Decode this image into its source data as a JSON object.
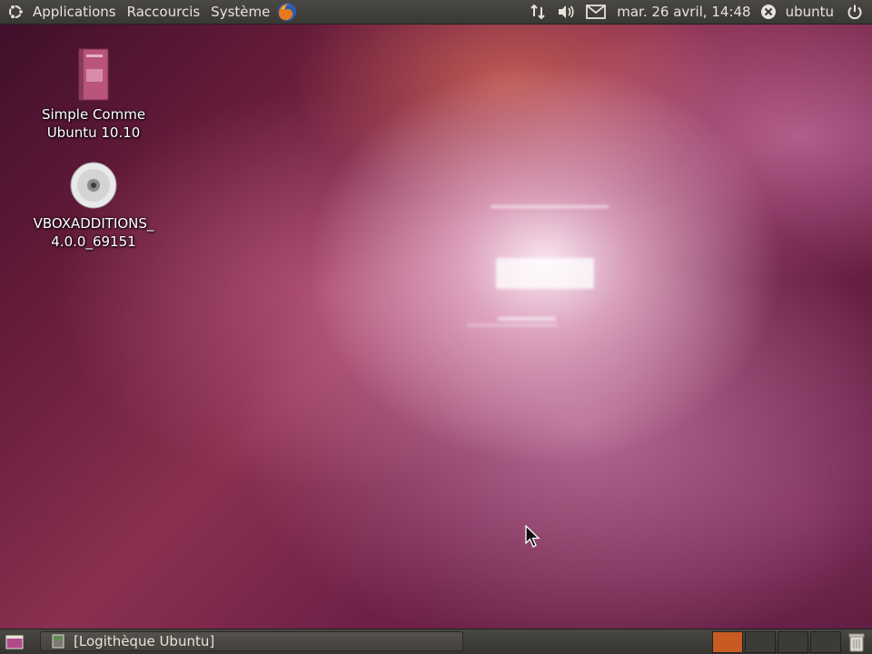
{
  "top_panel": {
    "menu_applications": "Applications",
    "menu_shortcuts": "Raccourcis",
    "menu_system": "Système",
    "clock": "mar. 26 avril, 14:48",
    "user": "ubuntu",
    "icons": [
      "ubuntu-logo-icon",
      "firefox-icon",
      "network-icon",
      "volume-icon",
      "mail-icon",
      "user-status-icon",
      "power-icon"
    ]
  },
  "desktop": {
    "icons": [
      {
        "label": "Simple Comme Ubuntu 10.10",
        "icon": "book-icon"
      },
      {
        "label": "VBOXADDITIONS_ 4.0.0_69151",
        "icon": "cd-icon"
      }
    ]
  },
  "bottom_panel": {
    "taskbar_window": "[Logithèque Ubuntu]",
    "icons": [
      "show-desktop-icon",
      "app-window-icon",
      "trash-icon"
    ],
    "active_workspace_color": "#c75b22"
  },
  "colors": {
    "panel": "#3c3b37",
    "wallpaper_base": "#6a1d3c",
    "accent_orange": "#c75b22"
  }
}
